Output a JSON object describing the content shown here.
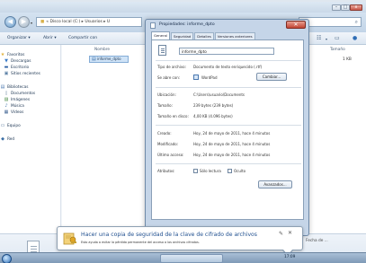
{
  "explorer": {
    "breadcrumb": "« Disco local (C:) ▸ Usuarios ▸ U",
    "toolbar": {
      "organize": "Organizar ▾",
      "open": "Abrir ▾",
      "share": "Compartir con"
    },
    "nav": {
      "items": [
        {
          "label": "Favoritos",
          "icon": "star-icon"
        },
        {
          "label": "Descargas",
          "icon": "download-folder-icon"
        },
        {
          "label": "Escritorio",
          "icon": "desktop-icon"
        },
        {
          "label": "Sitios recientes",
          "icon": "recent-places-icon"
        },
        {
          "label": "Bibliotecas",
          "icon": "library-icon"
        },
        {
          "label": "Documentos",
          "icon": "documents-icon"
        },
        {
          "label": "Imágenes",
          "icon": "pictures-icon"
        },
        {
          "label": "Música",
          "icon": "music-icon"
        },
        {
          "label": "Vídeos",
          "icon": "videos-icon"
        },
        {
          "label": "Equipo",
          "icon": "computer-icon"
        },
        {
          "label": "Red",
          "icon": "network-icon"
        }
      ]
    },
    "columns": {
      "name": "Nombre",
      "size": "Tamaño"
    },
    "file": {
      "name": "informe_dpto",
      "size": "1 KB"
    },
    "details_date": "Fecha de ..."
  },
  "dialog": {
    "title": "Propiedades: informe_dpto",
    "tabs": [
      "General",
      "Seguridad",
      "Detalles",
      "Versiones anteriores"
    ],
    "active_tab": "General",
    "file_name": "informe_dpto",
    "properties": {
      "type_label": "Tipo de archivo:",
      "type_value": "Documento de texto enriquecido (.rtf)",
      "opens_label": "Se abre con:",
      "opens_value": "WordPad",
      "change_button": "Cambiar...",
      "location_label": "Ubicación:",
      "location_value": "C:\\Users\\usuario\\Documents",
      "size_label": "Tamaño:",
      "size_value": "239 bytes (239 bytes)",
      "disk_label": "Tamaño en disco:",
      "disk_value": "4,00 KB (4.096 bytes)",
      "created_label": "Creado:",
      "created_value": "Hoy, 24 de mayo de 2011, hace 4 minutos",
      "modified_label": "Modificado:",
      "modified_value": "Hoy, 24 de mayo de 2011, hace 4 minutos",
      "accessed_label": "Último acceso:",
      "accessed_value": "Hoy, 24 de mayo de 2011, hace 4 minutos",
      "attributes_label": "Atributos:",
      "readonly_label": "Sólo lectura",
      "hidden_label": "Oculto",
      "advanced_button": "Avanzados..."
    }
  },
  "notification": {
    "title": "Hacer una copia de seguridad de la clave de cifrado de archivos",
    "text": "Esto ayuda a evitar la pérdida permanente del acceso a los archivos cifrados."
  },
  "taskbar": {
    "time": "17:09"
  },
  "colors": {
    "accent": "#1f4f8f",
    "selection": "#cfe3f7",
    "close_button": "#c24433"
  }
}
